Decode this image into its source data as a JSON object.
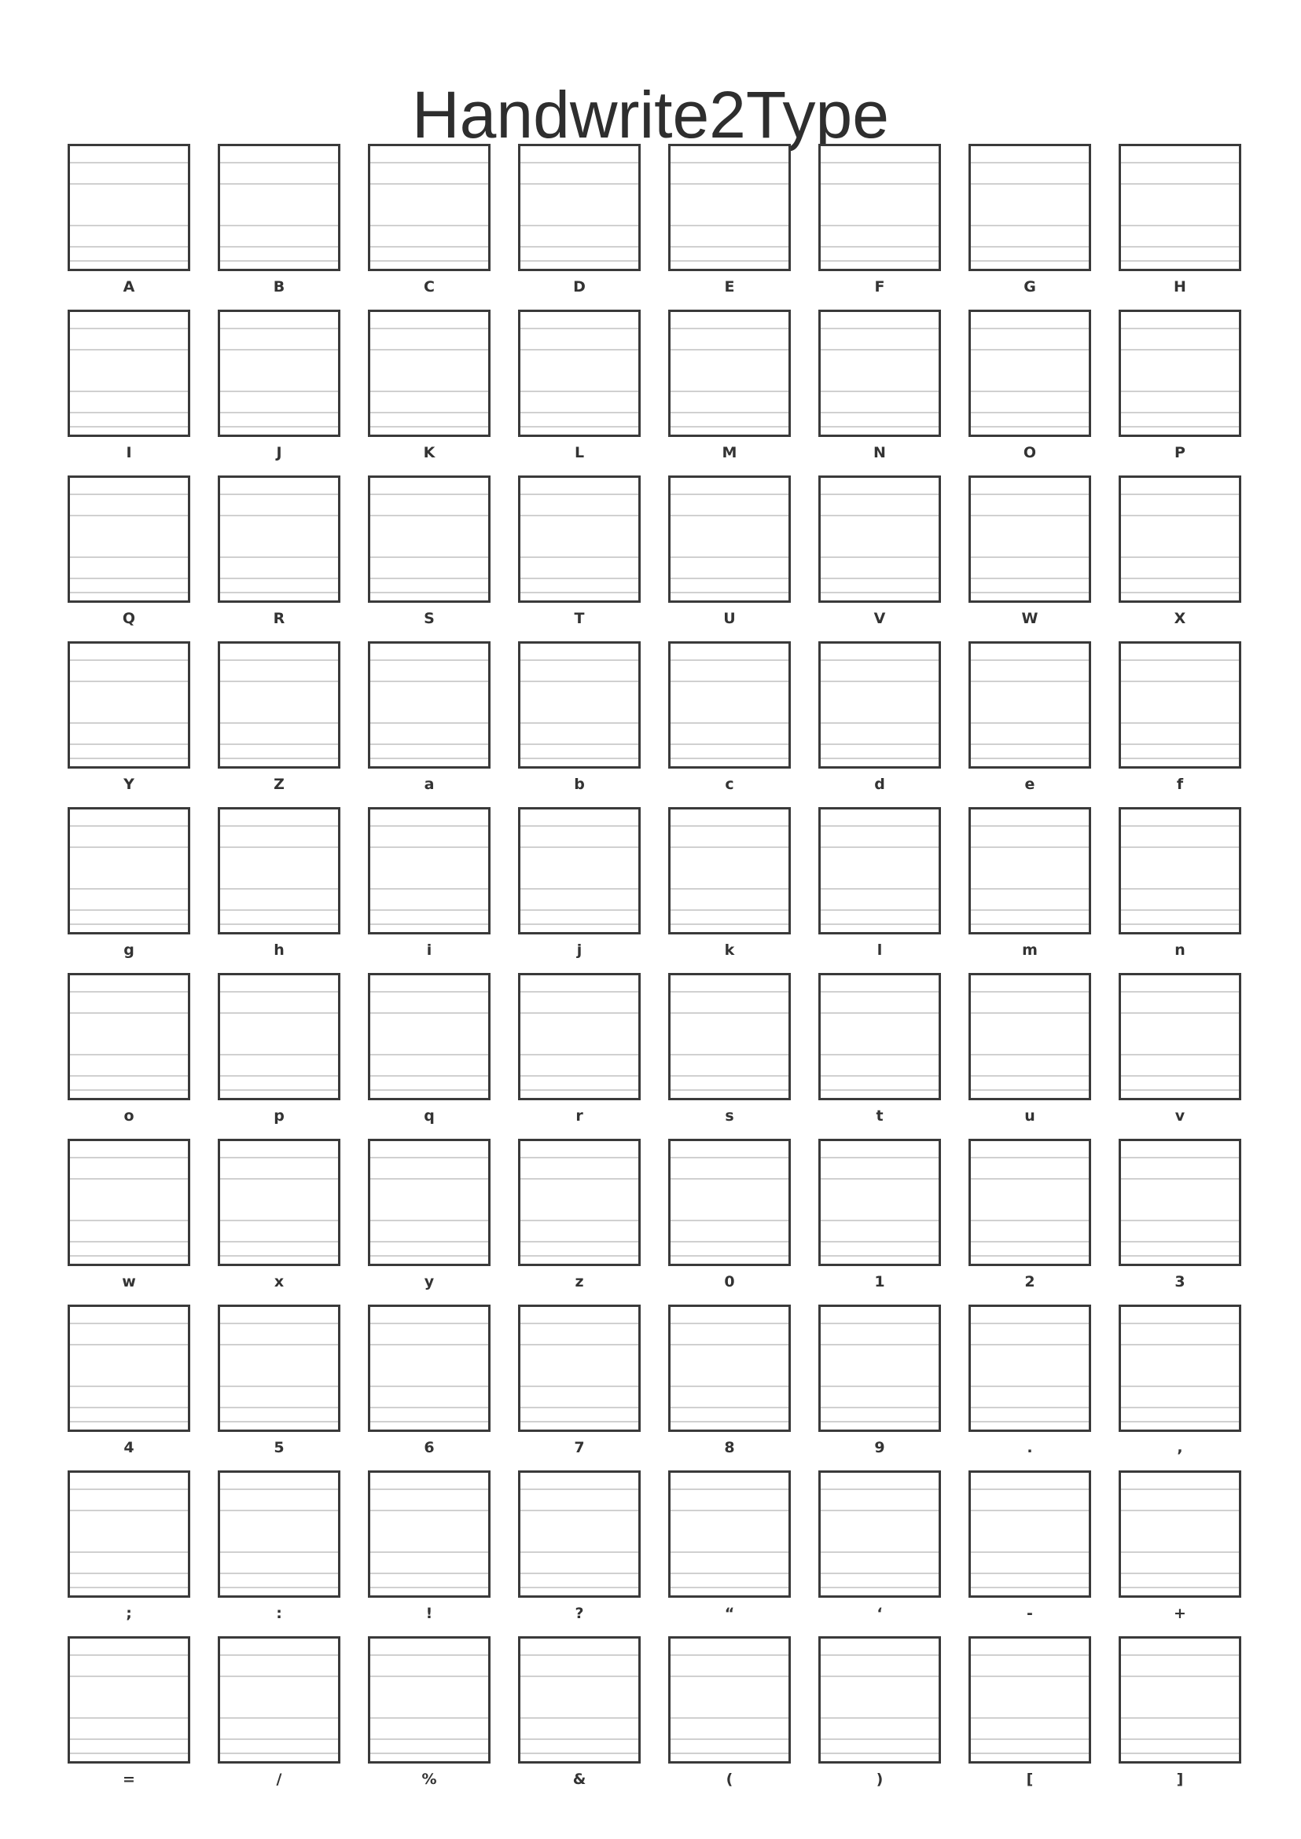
{
  "title": "Handwrite2Type",
  "characters": [
    "A",
    "B",
    "C",
    "D",
    "E",
    "F",
    "G",
    "H",
    "I",
    "J",
    "K",
    "L",
    "M",
    "N",
    "O",
    "P",
    "Q",
    "R",
    "S",
    "T",
    "U",
    "V",
    "W",
    "X",
    "Y",
    "Z",
    "a",
    "b",
    "c",
    "d",
    "e",
    "f",
    "g",
    "h",
    "i",
    "j",
    "k",
    "l",
    "m",
    "n",
    "o",
    "p",
    "q",
    "r",
    "s",
    "t",
    "u",
    "v",
    "w",
    "x",
    "y",
    "z",
    "0",
    "1",
    "2",
    "3",
    "4",
    "5",
    "6",
    "7",
    "8",
    "9",
    ".",
    ",",
    ";",
    ":",
    "!",
    "?",
    "“",
    "‘",
    "-",
    "+",
    "=",
    "/",
    "%",
    "&",
    "(",
    ")",
    "[",
    "]"
  ]
}
